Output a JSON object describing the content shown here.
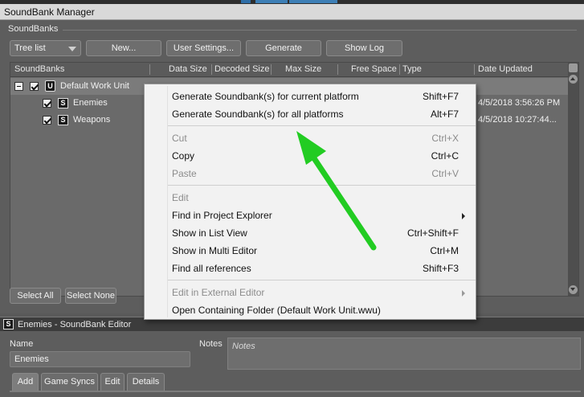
{
  "window": {
    "title": "SoundBank Manager"
  },
  "soundbanks": {
    "section_label": "SoundBanks",
    "view_select": "Tree list",
    "buttons": {
      "new": "New...",
      "user_settings": "User Settings...",
      "generate": "Generate",
      "show_log": "Show Log",
      "select_all": "Select All",
      "select_none": "Select None"
    },
    "columns": [
      "SoundBanks",
      "Data Size",
      "Decoded Size",
      "Max Size",
      "Free Space",
      "Type",
      "Date Updated"
    ],
    "rows": [
      {
        "name": "Default Work Unit",
        "icon": "work-unit-icon",
        "icon_glyph": "U",
        "date": ""
      },
      {
        "name": "Enemies",
        "icon": "soundbank-icon",
        "icon_glyph": "S",
        "date": "4/5/2018 3:56:26 PM"
      },
      {
        "name": "Weapons",
        "icon": "soundbank-icon",
        "icon_glyph": "S",
        "date": "4/5/2018 10:27:44..."
      }
    ]
  },
  "context_menu": {
    "items": [
      {
        "label": "Generate Soundbank(s) for current platform",
        "shortcut": "Shift+F7",
        "disabled": false
      },
      {
        "label": "Generate Soundbank(s) for all platforms",
        "shortcut": "Alt+F7",
        "disabled": false
      },
      {
        "label": "Cut",
        "shortcut": "Ctrl+X",
        "disabled": true
      },
      {
        "label": "Copy",
        "shortcut": "Ctrl+C",
        "disabled": false
      },
      {
        "label": "Paste",
        "shortcut": "Ctrl+V",
        "disabled": true
      },
      {
        "label": "Edit",
        "shortcut": "",
        "disabled": true
      },
      {
        "label": "Find in Project Explorer",
        "shortcut": "",
        "disabled": false,
        "submenu": true
      },
      {
        "label": "Show in List View",
        "shortcut": "Ctrl+Shift+F",
        "disabled": false
      },
      {
        "label": "Show in Multi Editor",
        "shortcut": "Ctrl+M",
        "disabled": false
      },
      {
        "label": "Find all references",
        "shortcut": "Shift+F3",
        "disabled": false
      },
      {
        "label": "Edit in External Editor",
        "shortcut": "",
        "disabled": true,
        "submenu": true
      },
      {
        "label": "Open Containing Folder (Default Work Unit.wwu)",
        "shortcut": "",
        "disabled": false
      }
    ]
  },
  "editor": {
    "title": "Enemies - SoundBank Editor",
    "name_label": "Name",
    "name_value": "Enemies",
    "notes_label": "Notes",
    "notes_placeholder": "Notes",
    "tabs": [
      "Add",
      "Game Syncs",
      "Edit",
      "Details"
    ]
  },
  "colors": {
    "annotation_arrow": "#22cc22",
    "menu_background": "#f2f2f2",
    "panel_background": "#5d5d5d"
  }
}
